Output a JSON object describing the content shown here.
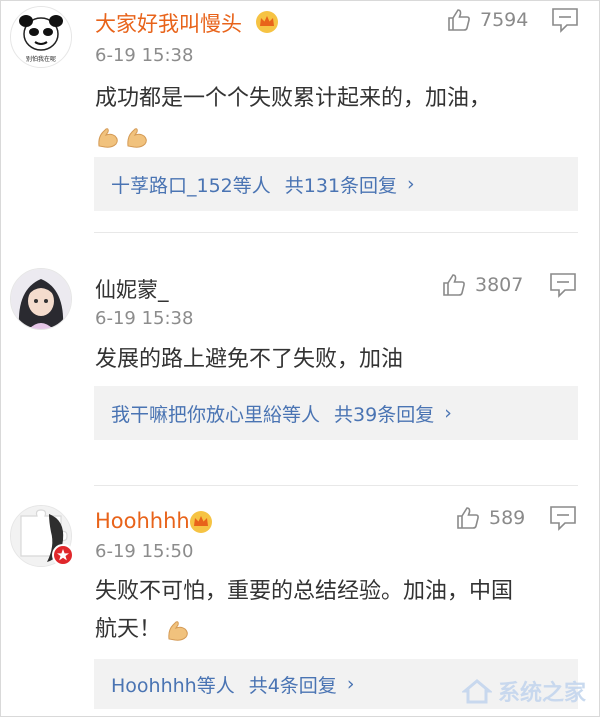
{
  "comments": [
    {
      "username": "大家好我叫慢头",
      "time": "6-19 15:38",
      "content": "成功都是一个个失败累计起来的，加油，",
      "emojis": [
        "muscle-emoji",
        "muscle-emoji"
      ],
      "likes": "7594",
      "avatar_caption": "别怕我在呢",
      "replies": {
        "users": "十莩路口_152等人",
        "count": "共131条回复",
        "chevron": "›"
      }
    },
    {
      "username": "仙妮蒙_",
      "time": "6-19 15:38",
      "content": "发展的路上避免不了失败，加油",
      "likes": "3807",
      "replies": {
        "users": "我干嘛把你放心里綌等人",
        "count": "共39条回复",
        "chevron": "›"
      }
    },
    {
      "username": "Hoohhhh",
      "time": "6-19 15:50",
      "content_line1": "失败不可怕，重要的总结经验。加油，中国",
      "content_line2": "航天！",
      "emojis": [
        "muscle-emoji"
      ],
      "likes": "589",
      "replies": {
        "users": "Hoohhhh等人",
        "count": "共4条回复",
        "chevron": "›"
      }
    }
  ],
  "watermark": "系统之家",
  "colors": {
    "vip_name": "#e8631a",
    "link": "#4a74b3",
    "meta": "#8c8c8c"
  }
}
